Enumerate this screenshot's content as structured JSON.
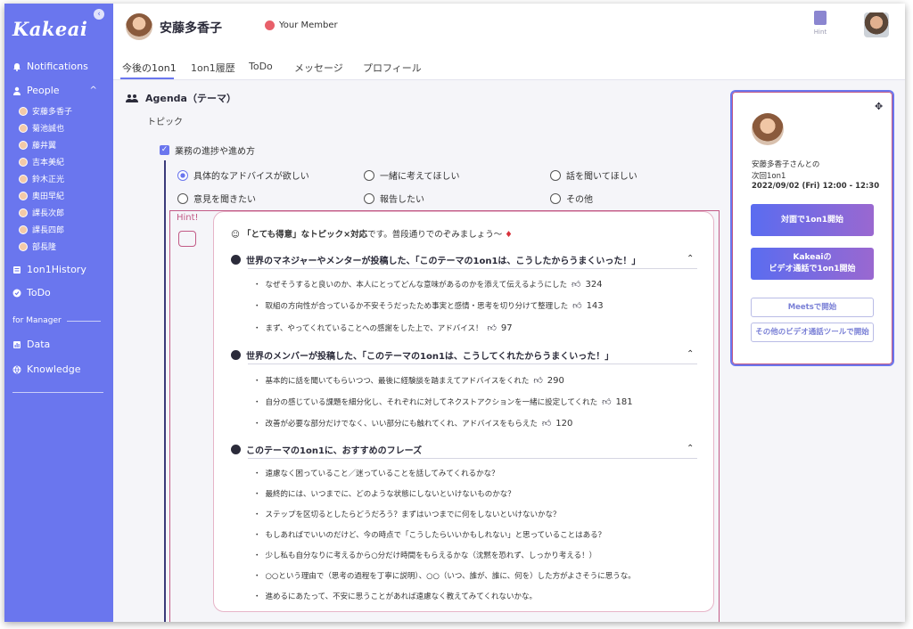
{
  "app": {
    "logo": "Kakeai",
    "collapse_icon": "chevron-icon"
  },
  "sidebar": {
    "notifications": "Notifications",
    "people": "People",
    "people_toggle": "^",
    "people_list": [
      "安藤多香子",
      "菊池誠也",
      "藤井翼",
      "吉本美紀",
      "鈴木正光",
      "奥田早紀",
      "課長次郎",
      "課長四郎",
      "部長隆"
    ],
    "history": "1on1History",
    "todo": "ToDo",
    "for_manager": "for Manager",
    "data": "Data",
    "knowledge": "Knowledge"
  },
  "header": {
    "name": "安藤多香子",
    "member_badge": "Your Member",
    "hint": "Hint"
  },
  "tabs": [
    "今後の1on1",
    "1on1履歴",
    "ToDo",
    "メッセージ",
    "プロフィール"
  ],
  "agenda": {
    "title": "Agenda（テーマ）",
    "topic_label": "トピック",
    "checkbox_label": "業務の進捗や進め方",
    "options": [
      "具体的なアドバイスが欲しい",
      "一緒に考えてほしい",
      "話を聞いてほしい",
      "意見を聞きたい",
      "報告したい",
      "その他"
    ]
  },
  "hint": {
    "tag": "Hint!",
    "intro_bold": "「とても得意」なトピック×対応",
    "intro_rest": "です。普段通りでのぞみましょう〜",
    "sections": [
      {
        "title": "世界のマネジャーやメンターが投稿した、「このテーマの1on1は、こうしたからうまくいった！」",
        "items": [
          {
            "text": "なぜそうすると良いのか、本人にとってどんな意味があるのかを添えて伝えるようにした",
            "count": "324"
          },
          {
            "text": "取組の方向性が合っているか不安そうだったため事実と感情・思考を切り分けて整理した",
            "count": "143"
          },
          {
            "text": "まず、やってくれていることへの感謝をした上で、アドバイス！",
            "count": "97"
          }
        ]
      },
      {
        "title": "世界のメンバーが投稿した、「このテーマの1on1は、こうしてくれたからうまくいった！」",
        "items": [
          {
            "text": "基本的に話を聞いてもらいつつ、最後に経験談を踏まえてアドバイスをくれた",
            "count": "290"
          },
          {
            "text": "自分の感じている課題を細分化し、それぞれに対してネクストアクションを一緒に設定してくれた",
            "count": "181"
          },
          {
            "text": "改善が必要な部分だけでなく、いい部分にも触れてくれ、アドバイスをもらえた",
            "count": "120"
          }
        ]
      },
      {
        "title": "このテーマの1on1に、おすすめのフレーズ",
        "items": [
          {
            "text": "遠慮なく困っていること／迷っていることを話してみてくれるかな？"
          },
          {
            "text": "最終的には、いつまでに、どのような状態にしないといけないものかな？"
          },
          {
            "text": "ステップを区切るとしたらどうだろう？まずはいつまでに何をしないといけないかな？"
          },
          {
            "text": "もしあればでいいのだけど、今の時点で「こうしたらいいかもしれない」と思っていることはある？"
          },
          {
            "text": "少し私も自分なりに考えるから○分だけ時間をもらえるかな（沈黙を恐れず、しっかり考える！）"
          },
          {
            "text": "○○という理由で（思考の過程を丁寧に説明）、○○（いつ、誰が、誰に、何を）した方がよさそうに思うな。"
          },
          {
            "text": "進めるにあたって、不安に思うことがあれば遠慮なく教えてみてくれないかな。"
          }
        ]
      }
    ]
  },
  "card": {
    "line1": "安藤多香子さんとの",
    "line2": "次回1on1",
    "line3": "2022/09/02 (Fri) 12:00 - 12:30",
    "btn_inperson": "対面で1on1開始",
    "btn_video_1": "Kakeaiの",
    "btn_video_2": "ビデオ通話で1on1開始",
    "btn_meets": "Meetsで開始",
    "btn_other": "その他のビデオ通話ツールで開始"
  },
  "colors": {
    "sidebar": "#6a76ee",
    "accent": "#6a76ee",
    "hint": "#c25a86"
  }
}
